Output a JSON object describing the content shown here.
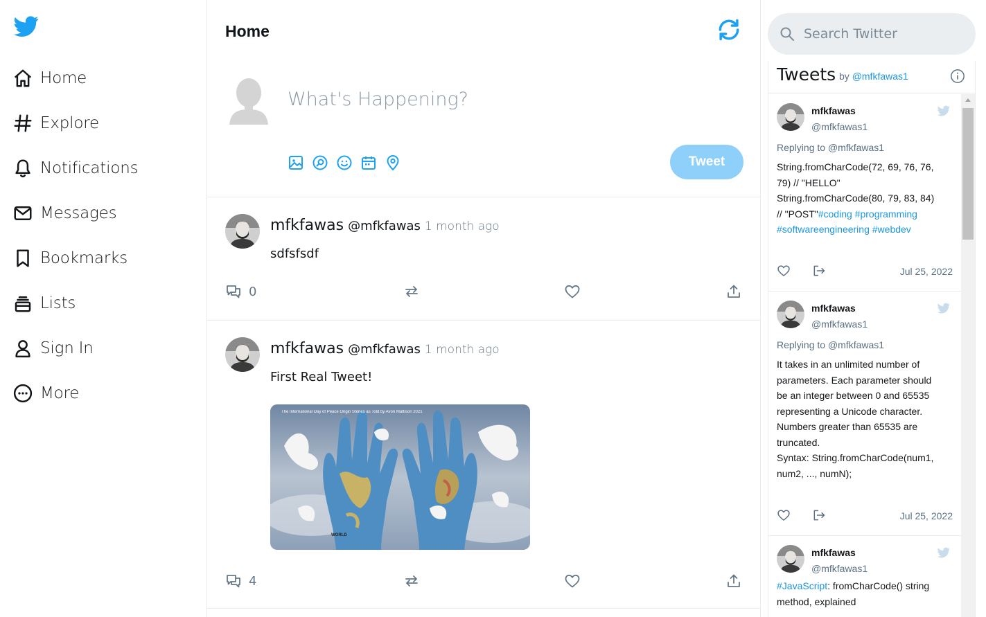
{
  "nav": {
    "items": [
      {
        "label": "Home",
        "icon": "home-icon"
      },
      {
        "label": "Explore",
        "icon": "hashtag-icon"
      },
      {
        "label": "Notifications",
        "icon": "bell-icon"
      },
      {
        "label": "Messages",
        "icon": "mail-icon"
      },
      {
        "label": "Bookmarks",
        "icon": "bookmark-icon"
      },
      {
        "label": "Lists",
        "icon": "list-icon"
      },
      {
        "label": "Sign In",
        "icon": "user-icon"
      },
      {
        "label": "More",
        "icon": "more-icon"
      }
    ]
  },
  "main": {
    "title": "Home",
    "compose": {
      "placeholder": "What's Happening?",
      "tools": [
        "image-icon",
        "gif-search-icon",
        "emoji-icon",
        "calendar-icon",
        "location-icon"
      ],
      "tweet_label": "Tweet"
    },
    "posts": [
      {
        "name": "mfkfawas",
        "handle": "@mfkfawas",
        "time": "1 month ago",
        "text": "sdfsfsdf",
        "replies": "0",
        "has_image": false
      },
      {
        "name": "mfkfawas",
        "handle": "@mfkfawas",
        "time": "1 month ago",
        "text": "First Real Tweet!",
        "replies": "4",
        "has_image": true,
        "image_caption": "The International Day of Peace Origin Stories as Told by Avon Mattison 2021",
        "image_label": "WORLD"
      }
    ]
  },
  "search": {
    "placeholder": "Search Twitter"
  },
  "widget": {
    "title": "Tweets",
    "by_prefix": "by",
    "by_handle": "@mfkfawas1",
    "tweets": [
      {
        "name": "mfkfawas",
        "handle": "@mfkfawas1",
        "reply_prefix": "Replying to",
        "reply_handle": "@mfkfawas1",
        "lines": [
          "String.fromCharCode(72, 69, 76, 76,",
          "79) // \"HELLO\"",
          "String.fromCharCode(80, 79, 83, 84)"
        ],
        "line4_text": "// \"POST\"",
        "line4_tags": [
          "#coding",
          "#programming"
        ],
        "line5_tags": [
          "#softwareengineering",
          "#webdev"
        ],
        "date": "Jul 25, 2022"
      },
      {
        "name": "mfkfawas",
        "handle": "@mfkfawas1",
        "reply_prefix": "Replying to",
        "reply_handle": "@mfkfawas1",
        "lines": [
          "It takes in an unlimited number of",
          "parameters. Each parameter should",
          "be an integer between 0 and 65535",
          "representing a Unicode character.",
          "Numbers greater than 65535 are",
          "truncated.",
          "Syntax: String.fromCharCode(num1,",
          "num2, ..., numN);"
        ],
        "date": "Jul 25, 2022"
      },
      {
        "name": "mfkfawas",
        "handle": "@mfkfawas1",
        "tag": "#JavaScript",
        "line1_rest": ": fromCharCode() string",
        "line2": "method, explained"
      }
    ]
  },
  "colors": {
    "brand": "#1da1f2",
    "tweet_button": "#8ed0f9",
    "link": "#1b95e0",
    "muted": "#657786"
  }
}
